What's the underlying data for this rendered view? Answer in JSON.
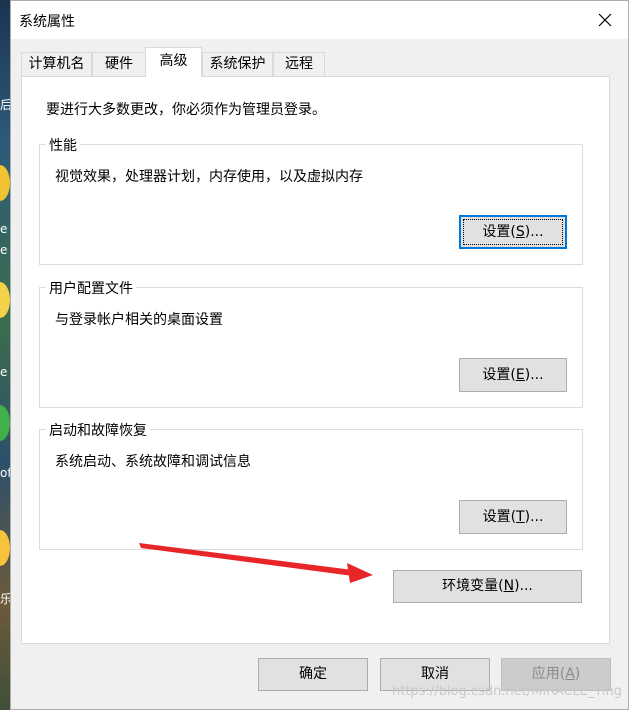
{
  "desktop": {
    "side_chars": [
      "后",
      "e",
      "e",
      "e",
      "of",
      "乐"
    ]
  },
  "window": {
    "title": "系统属性",
    "close_icon": "close-icon"
  },
  "tabs": [
    {
      "label": "计算机名",
      "active": false
    },
    {
      "label": "硬件",
      "active": false
    },
    {
      "label": "高级",
      "active": true
    },
    {
      "label": "系统保护",
      "active": false
    },
    {
      "label": "远程",
      "active": false
    }
  ],
  "advanced": {
    "admin_note": "要进行大多数更改，你必须作为管理员登录。",
    "groups": [
      {
        "title": "性能",
        "description": "视觉效果，处理器计划，内存使用，以及虚拟内存",
        "button": {
          "prefix": "设置(",
          "accel": "S",
          "suffix": ")..."
        }
      },
      {
        "title": "用户配置文件",
        "description": "与登录帐户相关的桌面设置",
        "button": {
          "prefix": "设置(",
          "accel": "E",
          "suffix": ")..."
        }
      },
      {
        "title": "启动和故障恢复",
        "description": "系统启动、系统故障和调试信息",
        "button": {
          "prefix": "设置(",
          "accel": "T",
          "suffix": ")..."
        }
      }
    ],
    "env_button": {
      "prefix": "环境变量(",
      "accel": "N",
      "suffix": ")..."
    }
  },
  "footer": {
    "ok": "确定",
    "cancel": "取消",
    "apply": {
      "prefix": "应用(",
      "accel": "A",
      "suffix": ")"
    }
  },
  "annotation": {
    "arrow_color": "#e8262a"
  },
  "watermark": "https://blog.csdn.net/MIRACLE_Ying",
  "colors": {
    "focus_border": "#0078d7",
    "button_bg": "#e1e1e1",
    "disabled_text": "#8a8a8a"
  }
}
